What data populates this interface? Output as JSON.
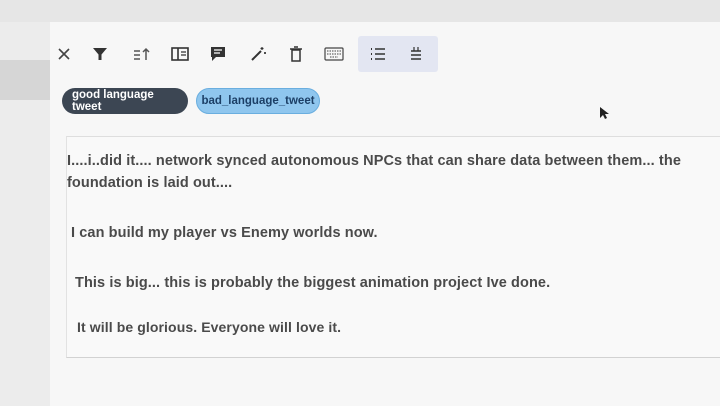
{
  "toolbar": {
    "icons": [
      "close-icon",
      "filter-icon",
      "sort-icon",
      "split-view-icon",
      "comment-icon",
      "magic-wand-icon",
      "delete-icon",
      "keyboard-icon",
      "list-icon",
      "menu-icon"
    ]
  },
  "labels": {
    "good": "good language tweet",
    "bad": "bad_language_tweet"
  },
  "document": {
    "line1": "I....i..did it.... network synced autonomous NPCs that can share data between them... the",
    "line2": "foundation is laid out....",
    "line3": "I can build my player vs Enemy worlds now.",
    "line4": "This is big... this is probably the biggest animation project Ive done.",
    "line5": "It will be glorious. Everyone will love it."
  },
  "colors": {
    "good_label_bg": "#3c4653",
    "bad_label_bg": "#8fc6ee"
  }
}
